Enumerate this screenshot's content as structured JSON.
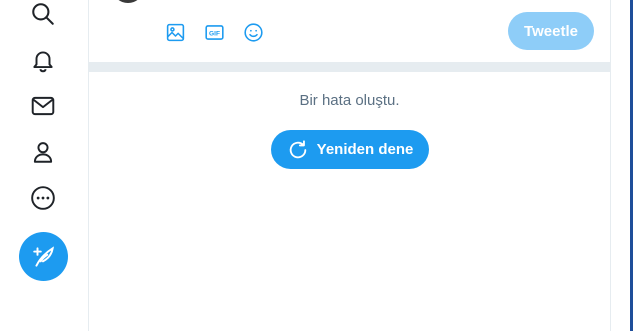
{
  "nav": {
    "items": [
      {
        "icon": "search-icon"
      },
      {
        "icon": "bell-icon"
      },
      {
        "icon": "mail-icon"
      },
      {
        "icon": "person-icon"
      },
      {
        "icon": "more-icon"
      }
    ],
    "compose": {
      "icon": "feather-plus-icon"
    }
  },
  "composer": {
    "tools": [
      "image-icon",
      "gif-icon",
      "emoji-icon"
    ],
    "gif_label": "GIF",
    "tweet_label": "Tweetle"
  },
  "error": {
    "message": "Bir hata oluştu.",
    "retry_label": "Yeniden dene"
  },
  "colors": {
    "accent": "#1d9bf0",
    "accent_disabled": "#8ecdf8",
    "divider": "#e6ecf0",
    "muted_text": "#5b7083"
  }
}
